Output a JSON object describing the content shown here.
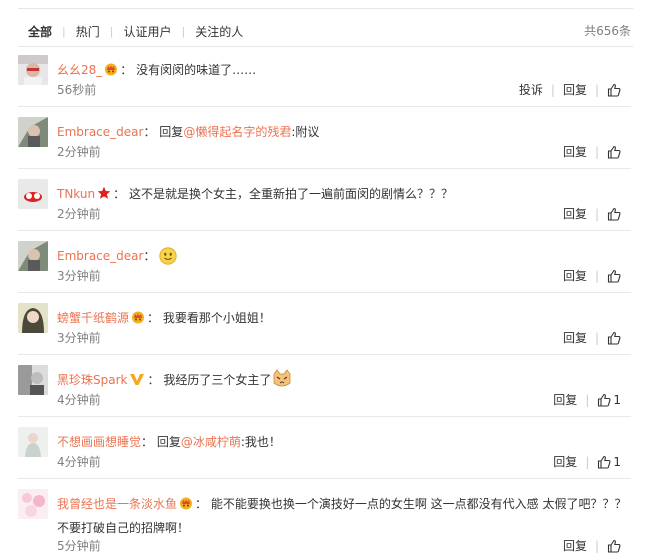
{
  "tabs": [
    "全部",
    "热门",
    "认证用户",
    "关注的人"
  ],
  "total": "共656条",
  "actions": {
    "report": "投诉",
    "reply": "回复"
  },
  "colors": {
    "accent": "#eb7350",
    "muted": "#808080",
    "divider": "#e9e9e9"
  },
  "comments": [
    {
      "user": "幺幺28_",
      "sep": "：",
      "text": "没有闵闵的味道了……",
      "time": "56秒前",
      "badge": "crown-badge-icon",
      "likes": ""
    },
    {
      "user": "Embrace_dear",
      "sep": "：",
      "prefix": "回复",
      "mention": "@懒得起名字的残君",
      "text": ":附议",
      "time": "2分钟前",
      "likes": ""
    },
    {
      "user": "TNkun",
      "sep": "：",
      "text": "这不是就是换个女主，全重新拍了一遍前面闵的剧情么？？？",
      "time": "2分钟前",
      "badge": "star-badge-icon",
      "likes": ""
    },
    {
      "user": "Embrace_dear",
      "sep": "：",
      "text": "",
      "time": "3分钟前",
      "emoji": "smile-emoji-icon",
      "likes": ""
    },
    {
      "user": "螃蟹千纸鹤源",
      "sep": "：",
      "text": "我要看那个小姐姐！",
      "time": "3分钟前",
      "badge": "crown-badge-icon",
      "likes": ""
    },
    {
      "user": "黑珍珠Spark",
      "sep": "：",
      "text": "我经历了三个女主了",
      "time": "4分钟前",
      "badge": "v-badge-icon",
      "emoji": "cat-emoji-icon",
      "likes": "1"
    },
    {
      "user": "不想画画想睡觉",
      "sep": "：",
      "prefix": "回复",
      "mention": "@冰咸柠萌",
      "text": ":我也！",
      "time": "4分钟前",
      "likes": "1"
    },
    {
      "user": "我曾经也是一条淡水鱼",
      "sep": "：",
      "text": "能不能要换也换一个演技好一点的女生啊 这一点都没有代入感 太假了吧？？？",
      "text2": "不要打破自己的招牌啊！",
      "time": "5分钟前",
      "badge": "crown-badge-icon",
      "likes": ""
    }
  ]
}
